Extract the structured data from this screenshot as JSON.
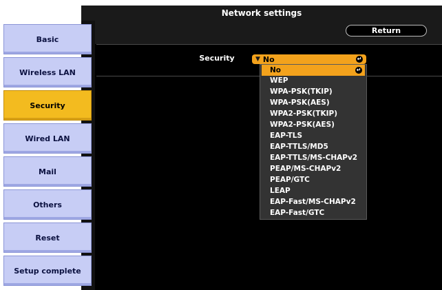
{
  "window": {
    "title": "Network settings"
  },
  "toolbar": {
    "return_label": "Return"
  },
  "sidebar": {
    "items": [
      {
        "label": "Basic",
        "active": false
      },
      {
        "label": "Wireless LAN",
        "active": false
      },
      {
        "label": "Security",
        "active": true
      },
      {
        "label": "Wired LAN",
        "active": false
      },
      {
        "label": "Mail",
        "active": false
      },
      {
        "label": "Others",
        "active": false
      },
      {
        "label": "Reset",
        "active": false
      },
      {
        "label": "Setup complete",
        "active": false
      }
    ]
  },
  "form": {
    "security": {
      "label": "Security",
      "value": "No",
      "options": [
        "No",
        "WEP",
        "WPA-PSK(TKIP)",
        "WPA-PSK(AES)",
        "WPA2-PSK(TKIP)",
        "WPA2-PSK(AES)",
        "EAP-TLS",
        "EAP-TTLS/MD5",
        "EAP-TTLS/MS-CHAPv2",
        "PEAP/MS-CHAPv2",
        "PEAP/GTC",
        "LEAP",
        "EAP-Fast/MS-CHAPv2",
        "EAP-Fast/GTC"
      ],
      "selected_index": 0
    }
  },
  "colors": {
    "active_tab": "#f3bb1f",
    "inactive_tab": "#c7cdf5",
    "accent_orange": "#f3a21c",
    "background": "#000000"
  },
  "icons": {
    "dropdown_arrow": "triangle-down-icon",
    "enter": "enter-icon"
  }
}
